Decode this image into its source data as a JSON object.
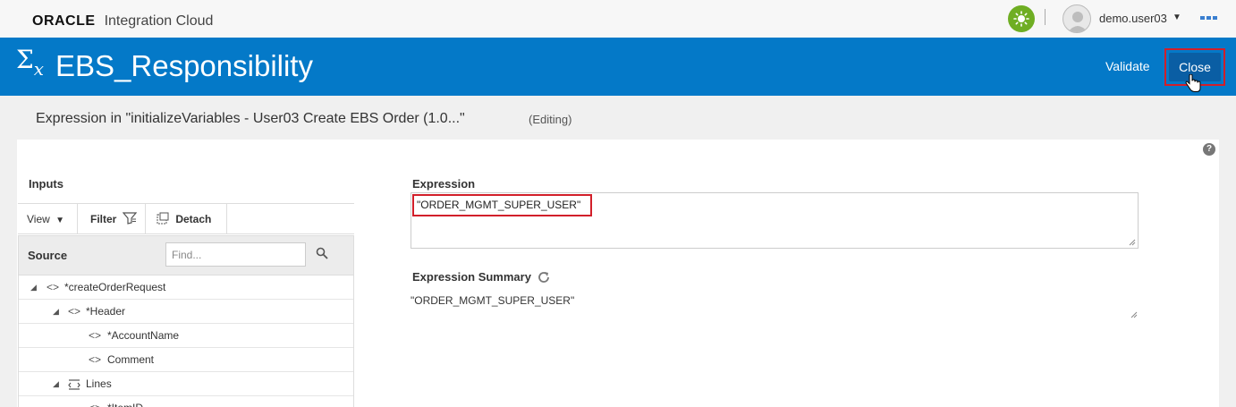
{
  "header": {
    "brand": "ORACLE",
    "app_name": "Integration Cloud",
    "user": "demo.user03",
    "icons": [
      "sun-icon",
      "avatar-icon",
      "caret-down-icon",
      "menu-dots-icon"
    ]
  },
  "titlebar": {
    "symbol": "Σ",
    "symbol_sub": "x",
    "title": "EBS_Responsibility",
    "validate_label": "Validate",
    "close_label": "Close"
  },
  "subheader": {
    "title": "Expression in \"initializeVariables - User03 Create EBS Order (1.0...\"",
    "mode": "(Editing)"
  },
  "inputs": {
    "title": "Inputs",
    "toolbar": {
      "view": "View",
      "filter": "Filter",
      "detach": "Detach"
    },
    "source_label": "Source",
    "find_placeholder": "Find...",
    "tree": [
      {
        "label": "*createOrderRequest",
        "expanded": true,
        "level": 0,
        "icon": "element-icon"
      },
      {
        "label": "*Header",
        "expanded": true,
        "level": 1,
        "icon": "element-icon"
      },
      {
        "label": "*AccountName",
        "level": 2,
        "icon": "element-icon"
      },
      {
        "label": "Comment",
        "level": 2,
        "icon": "element-icon"
      },
      {
        "label": "Lines",
        "expanded": true,
        "level": 1,
        "icon": "repeating-element-icon"
      },
      {
        "label": "*ItemID",
        "level": 2,
        "icon": "element-icon"
      }
    ]
  },
  "expression": {
    "label": "Expression",
    "value": "\"ORDER_MGMT_SUPER_USER\"",
    "summary_label": "Expression Summary",
    "summary_value": "\"ORDER_MGMT_SUPER_USER\""
  },
  "colors": {
    "titlebar": "#0479c8",
    "close_button": "#0a5ea4",
    "highlight": "#d21f2a",
    "sun_button": "#6fae23"
  }
}
